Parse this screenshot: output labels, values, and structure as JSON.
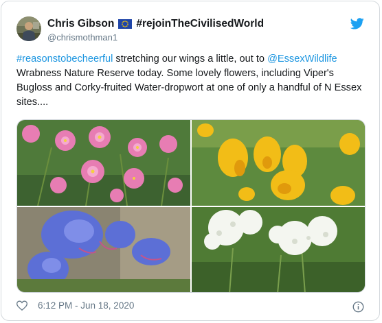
{
  "user": {
    "name": "Chris Gibson",
    "flag_icon": "eu-flag-icon",
    "name_hashtag": "#rejoinTheCivilisedWorld",
    "handle": "@chrismothman1"
  },
  "tweet": {
    "hashtag": "#reasonstobecheerful",
    "text_1": " stretching our wings a little, out to ",
    "mention": "@EssexWildlife",
    "text_2": " Wrabness Nature Reserve today. Some lovely flowers, including Viper's Bugloss and Corky-fruited Water-dropwort at one of only a handful of N Essex sites...."
  },
  "footer": {
    "time": "6:12 PM - Jun 18, 2020"
  },
  "icons": {
    "brand": "twitter-bird-icon",
    "like": "heart-icon",
    "info": "info-icon"
  },
  "colors": {
    "link": "#1b95e0",
    "twitter_blue": "#1da1f2",
    "secondary_text": "#657786"
  }
}
